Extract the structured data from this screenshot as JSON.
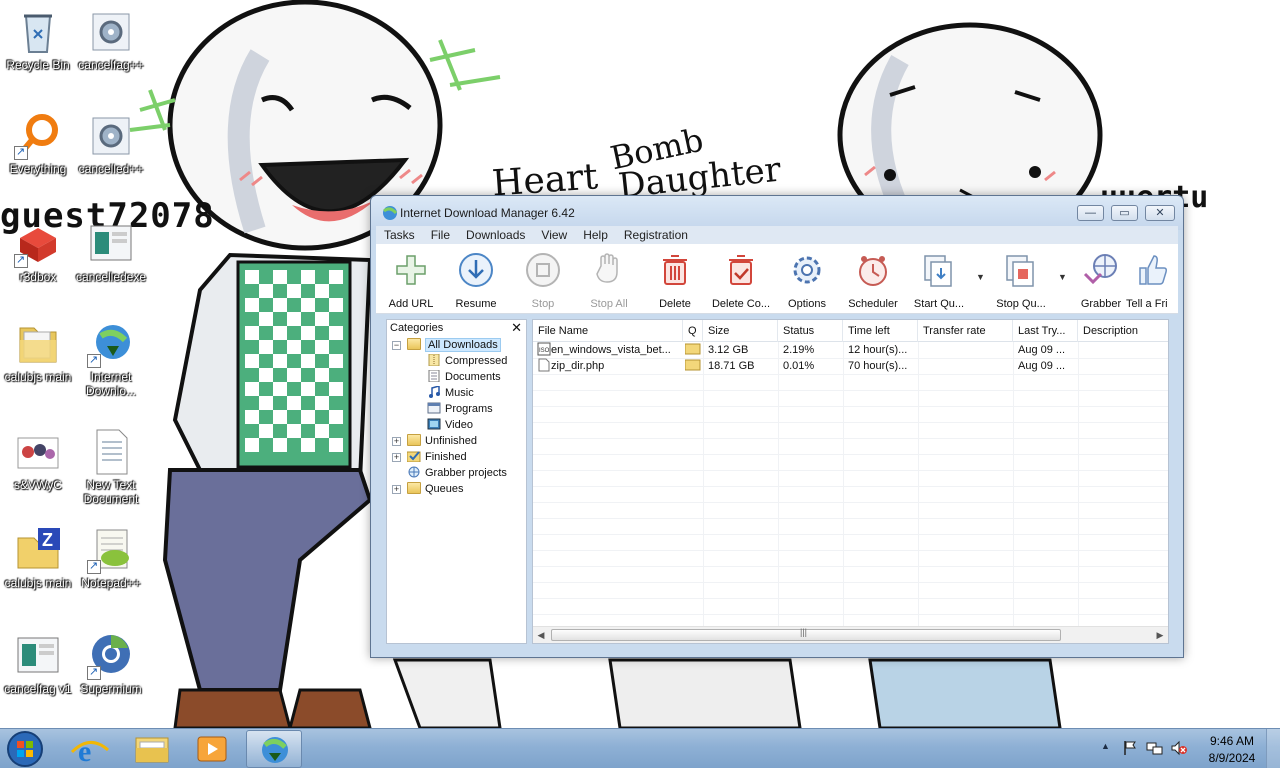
{
  "desktop": {
    "wallpaper_texts": {
      "heart": "Heart",
      "bomb": "Bomb",
      "daughter": "Daughter",
      "guest": "guest72078",
      "name2": "uuertu"
    },
    "icons": [
      {
        "label": "Recycle Bin",
        "icon": "recycle-bin-icon"
      },
      {
        "label": "cancelfag++",
        "icon": "settings-app-icon"
      },
      {
        "label": "Everything",
        "icon": "everything-search-icon"
      },
      {
        "label": "cancelled++",
        "icon": "settings-app-icon"
      },
      {
        "label": "r3dbox",
        "icon": "redbox-icon"
      },
      {
        "label": "cancelledexe",
        "icon": "window-app-icon"
      },
      {
        "label": "calubjs main",
        "icon": "folder-icon"
      },
      {
        "label": "Internet Downlo...",
        "icon": "idm-icon"
      },
      {
        "label": "s&VWyC",
        "icon": "image-file-icon"
      },
      {
        "label": "New Text Document",
        "icon": "text-document-icon"
      },
      {
        "label": "calubjs main",
        "icon": "zip-folder-icon"
      },
      {
        "label": "Notepad++",
        "icon": "notepad-plus-plus-icon"
      },
      {
        "label": "cancelfag v1",
        "icon": "window-app-icon"
      },
      {
        "label": "Supermium",
        "icon": "supermium-browser-icon"
      }
    ]
  },
  "idm": {
    "title": "Internet Download Manager 6.42",
    "window_buttons": {
      "minimize": "—",
      "maximize": "▭",
      "close": "✕"
    },
    "menu": [
      "Tasks",
      "File",
      "Downloads",
      "View",
      "Help",
      "Registration"
    ],
    "toolbar": [
      {
        "label": "Add URL",
        "icon": "add-url-icon",
        "enabled": true
      },
      {
        "label": "Resume",
        "icon": "resume-icon",
        "enabled": true
      },
      {
        "label": "Stop",
        "icon": "stop-icon",
        "enabled": false
      },
      {
        "label": "Stop All",
        "icon": "stop-all-icon",
        "enabled": false
      },
      {
        "label": "Delete",
        "icon": "delete-icon",
        "enabled": true
      },
      {
        "label": "Delete Co...",
        "icon": "delete-completed-icon",
        "enabled": true
      },
      {
        "label": "Options",
        "icon": "options-gear-icon",
        "enabled": true
      },
      {
        "label": "Scheduler",
        "icon": "scheduler-clock-icon",
        "enabled": true
      },
      {
        "label": "Start Qu...",
        "icon": "start-queue-icon",
        "enabled": true
      },
      {
        "label": "Stop Qu...",
        "icon": "stop-queue-icon",
        "enabled": true
      },
      {
        "label": "Grabber",
        "icon": "grabber-icon",
        "enabled": true
      },
      {
        "label": "Tell a Fri",
        "icon": "tell-a-friend-icon",
        "enabled": true
      }
    ],
    "categories": {
      "header": "Categories",
      "close": "✕",
      "tree": [
        {
          "label": "All Downloads",
          "level": 0,
          "expander": "−",
          "selected": true,
          "icon": "folder-open-icon"
        },
        {
          "label": "Compressed",
          "level": 1,
          "icon": "compressed-icon"
        },
        {
          "label": "Documents",
          "level": 1,
          "icon": "documents-icon"
        },
        {
          "label": "Music",
          "level": 1,
          "icon": "music-icon"
        },
        {
          "label": "Programs",
          "level": 1,
          "icon": "programs-icon"
        },
        {
          "label": "Video",
          "level": 1,
          "icon": "video-icon"
        },
        {
          "label": "Unfinished",
          "level": 0,
          "expander": "+",
          "icon": "unfinished-folder-icon"
        },
        {
          "label": "Finished",
          "level": 0,
          "expander": "+",
          "icon": "finished-folder-icon"
        },
        {
          "label": "Grabber projects",
          "level": 0,
          "icon": "grabber-projects-icon"
        },
        {
          "label": "Queues",
          "level": 0,
          "expander": "+",
          "icon": "queues-folder-icon"
        }
      ]
    },
    "columns": [
      "File Name",
      "Q",
      "Size",
      "Status",
      "Time left",
      "Transfer rate",
      "Last Try...",
      "Description"
    ],
    "rows": [
      {
        "name": "en_windows_vista_bet...",
        "q": "",
        "size": "3.12  GB",
        "status": "2.19%",
        "time_left": "12 hour(s)...",
        "rate": "",
        "last_try": "Aug 09 ...",
        "description": "",
        "icon": "iso-file-icon"
      },
      {
        "name": "zip_dir.php",
        "q": "",
        "size": "18.71  GB",
        "status": "0.01%",
        "time_left": "70 hour(s)...",
        "rate": "",
        "last_try": "Aug 09 ...",
        "description": "",
        "icon": "generic-file-icon"
      }
    ],
    "scroll": {
      "left": "◀",
      "right": "▶",
      "grip": "|||"
    }
  },
  "taskbar": {
    "apps": [
      "internet-explorer-icon",
      "file-explorer-icon",
      "media-player-icon",
      "idm-icon"
    ],
    "tray": {
      "show_hidden": "▲",
      "flag": "action-center-flag-icon",
      "network": "network-icon",
      "volume": "volume-muted-icon"
    },
    "time": "9:46 AM",
    "date": "8/9/2024"
  },
  "colors": {
    "title_bar": "#c9dbee",
    "taskbar": "#8eb0d5",
    "selection": "#cde8ff"
  }
}
